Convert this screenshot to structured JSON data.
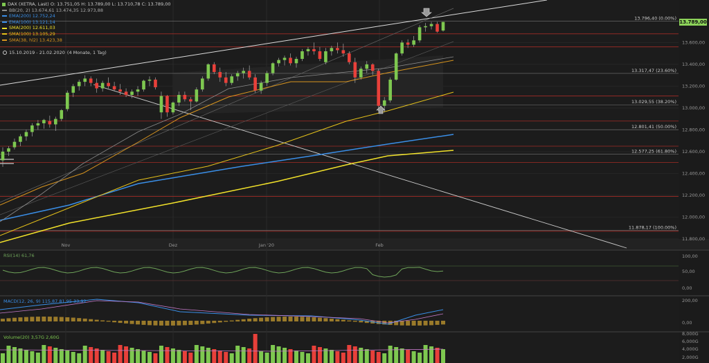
{
  "legend": {
    "title": "DAX (XETRA, Last)  O: 13.751,05  H: 13.789,00  L: 13.710,78  C: 13.789,00",
    "bb": "BB(20, 2)  13.674,61  13.474,35  12.973,88",
    "ema200": "EMA(200)  12.752,24",
    "ema100": "EMA(100)  13.121,14",
    "sma200": "SMA(200)  12.611,03",
    "sma100": "SMA(100)  13.105,29",
    "sma38": "SMA(38, hl2)  13.423,38"
  },
  "date_range": "15.10.2019 - 21.02.2020",
  "date_detail": "(4 Monate, 1 Tag)",
  "price_badge": "13.789,00",
  "colors": {
    "up": "#7ec850",
    "down": "#e8403a",
    "ema200": "#3a8fe8",
    "ema100": "#3a8fe8",
    "sma200": "#f2e22a",
    "sma100": "#e6c21a",
    "sma38": "#d9951e",
    "bb": "#8c8c8c",
    "fib": "#c0392b",
    "rsi": "#6fa45a",
    "macd": "#3a8fe8",
    "signal": "#c47ac9",
    "hist": "#9a7a2a",
    "volume_up": "#7ec850",
    "volume_down": "#e8403a"
  },
  "chart_data": {
    "type": "candlestick",
    "x_ticks": [
      "Nov",
      "Dez",
      "Jan '20",
      "Feb"
    ],
    "y_ticks": [
      "13.600,00",
      "13.400,00",
      "13.200,00",
      "13.000,00",
      "12.800,00",
      "12.600,00",
      "12.400,00",
      "12.200,00",
      "12.000,00",
      "11.800,00"
    ],
    "y_range": [
      11780,
      13990
    ],
    "fib_levels": [
      {
        "value": 13796.4,
        "label": "13.796,40 (0.00%)"
      },
      {
        "value": 13317.47,
        "label": "13.317,47 (23.60%)"
      },
      {
        "value": 13029.55,
        "label": "13.029,55 (38.20%)"
      },
      {
        "value": 12801.41,
        "label": "12.801,41 (50.00%)"
      },
      {
        "value": 12577.25,
        "label": "12.577,25 (61.80%)"
      },
      {
        "value": 11878.17,
        "label": "11.878,17 (100.00%)"
      }
    ],
    "red_levels": [
      13680,
      13560,
      13110,
      12880,
      12650,
      12500,
      12190,
      11870
    ],
    "candles": [
      [
        12520,
        12640,
        12460,
        12600
      ],
      [
        12600,
        12650,
        12560,
        12630
      ],
      [
        12640,
        12720,
        12620,
        12690
      ],
      [
        12690,
        12760,
        12650,
        12740
      ],
      [
        12740,
        12800,
        12700,
        12780
      ],
      [
        12780,
        12860,
        12740,
        12840
      ],
      [
        12840,
        12890,
        12800,
        12860
      ],
      [
        12860,
        12900,
        12810,
        12890
      ],
      [
        12880,
        12930,
        12820,
        12850
      ],
      [
        12850,
        12920,
        12790,
        12900
      ],
      [
        12900,
        12990,
        12880,
        12980
      ],
      [
        12990,
        13160,
        12970,
        13140
      ],
      [
        13140,
        13220,
        13100,
        13200
      ],
      [
        13200,
        13260,
        13160,
        13240
      ],
      [
        13240,
        13300,
        13200,
        13270
      ],
      [
        13270,
        13290,
        13200,
        13230
      ],
      [
        13230,
        13270,
        13140,
        13180
      ],
      [
        13180,
        13250,
        13150,
        13230
      ],
      [
        13230,
        13280,
        13180,
        13200
      ],
      [
        13200,
        13240,
        13160,
        13170
      ],
      [
        13170,
        13220,
        13120,
        13150
      ],
      [
        13150,
        13180,
        13100,
        13120
      ],
      [
        13120,
        13170,
        13090,
        13150
      ],
      [
        13150,
        13200,
        13110,
        13170
      ],
      [
        13170,
        13260,
        13150,
        13250
      ],
      [
        13250,
        13290,
        13200,
        13260
      ],
      [
        13260,
        13280,
        13170,
        13190
      ],
      [
        12960,
        13150,
        12900,
        13110
      ],
      [
        13110,
        13120,
        12920,
        12960
      ],
      [
        12960,
        13060,
        12940,
        13050
      ],
      [
        13050,
        13150,
        13020,
        13120
      ],
      [
        13120,
        13150,
        13060,
        13080
      ],
      [
        13080,
        13100,
        12980,
        13060
      ],
      [
        13060,
        13190,
        13050,
        13170
      ],
      [
        13170,
        13290,
        13150,
        13270
      ],
      [
        13270,
        13410,
        13250,
        13400
      ],
      [
        13400,
        13420,
        13310,
        13330
      ],
      [
        13330,
        13370,
        13240,
        13280
      ],
      [
        13280,
        13330,
        13200,
        13230
      ],
      [
        13230,
        13310,
        13210,
        13290
      ],
      [
        13290,
        13340,
        13250,
        13320
      ],
      [
        13320,
        13370,
        13270,
        13340
      ],
      [
        13340,
        13390,
        13260,
        13280
      ],
      [
        13280,
        13310,
        13140,
        13160
      ],
      [
        13160,
        13250,
        13130,
        13230
      ],
      [
        13230,
        13340,
        13200,
        13320
      ],
      [
        13320,
        13420,
        13300,
        13410
      ],
      [
        13410,
        13460,
        13380,
        13440
      ],
      [
        13440,
        13480,
        13390,
        13460
      ],
      [
        13460,
        13500,
        13390,
        13410
      ],
      [
        13410,
        13470,
        13370,
        13450
      ],
      [
        13450,
        13540,
        13430,
        13520
      ],
      [
        13520,
        13560,
        13480,
        13540
      ],
      [
        13540,
        13600,
        13490,
        13520
      ],
      [
        13520,
        13560,
        13430,
        13450
      ],
      [
        13420,
        13550,
        13400,
        13520
      ],
      [
        13520,
        13570,
        13480,
        13550
      ],
      [
        13550,
        13600,
        13500,
        13530
      ],
      [
        13530,
        13590,
        13470,
        13500
      ],
      [
        13500,
        13520,
        13400,
        13420
      ],
      [
        13420,
        13460,
        13230,
        13280
      ],
      [
        13280,
        13380,
        13260,
        13360
      ],
      [
        13360,
        13430,
        13320,
        13400
      ],
      [
        13400,
        13410,
        13300,
        13340
      ],
      [
        13340,
        13360,
        12970,
        13020
      ],
      [
        13020,
        13100,
        12960,
        13070
      ],
      [
        13070,
        13280,
        13050,
        13260
      ],
      [
        13260,
        13510,
        13250,
        13500
      ],
      [
        13500,
        13620,
        13480,
        13600
      ],
      [
        13600,
        13630,
        13550,
        13580
      ],
      [
        13580,
        13660,
        13560,
        13620
      ],
      [
        13620,
        13760,
        13600,
        13740
      ],
      [
        13740,
        13780,
        13700,
        13750
      ],
      [
        13750,
        13790,
        13720,
        13770
      ],
      [
        13770,
        13790,
        13690,
        13700
      ],
      [
        13710,
        13790,
        13700,
        13789
      ]
    ],
    "rsi": {
      "label": "RSI(14)  61,76",
      "y_ticks": [
        "100,00",
        "50,00",
        "0,00"
      ]
    },
    "macd": {
      "label": "MACD(12, 26, 9)  115,87  81,95  33,92",
      "y_ticks": [
        "200,00",
        "0,00"
      ]
    },
    "volume": {
      "label": "Volume(20)  3,57G  2,60G",
      "y_ticks": [
        "8,000G",
        "6,000G",
        "4,000G",
        "2,000G"
      ]
    }
  }
}
